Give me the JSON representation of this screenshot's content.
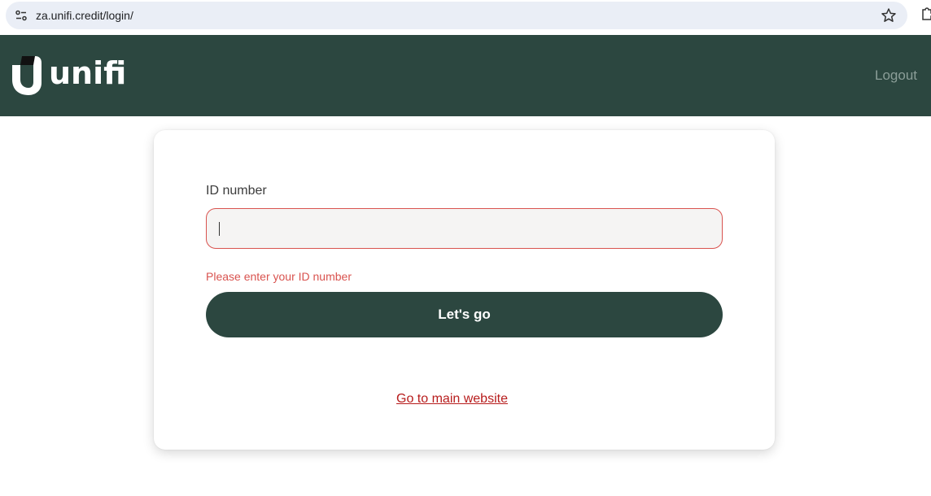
{
  "browser": {
    "url": "za.unifi.credit/login/",
    "icons": {
      "site_info": "site-settings-icon",
      "bookmark": "star-icon",
      "extensions": "puzzle-icon"
    }
  },
  "header": {
    "brand": "unifi",
    "logout_label": "Logout",
    "background_color": "#2c4740"
  },
  "form": {
    "id_label": "ID number",
    "id_value": "",
    "error_message": "Please enter your ID number",
    "submit_label": "Let's go",
    "main_site_link": "Go to main website"
  },
  "colors": {
    "brand": "#2c4740",
    "error": "#d9534f",
    "link": "#b71c1c"
  }
}
